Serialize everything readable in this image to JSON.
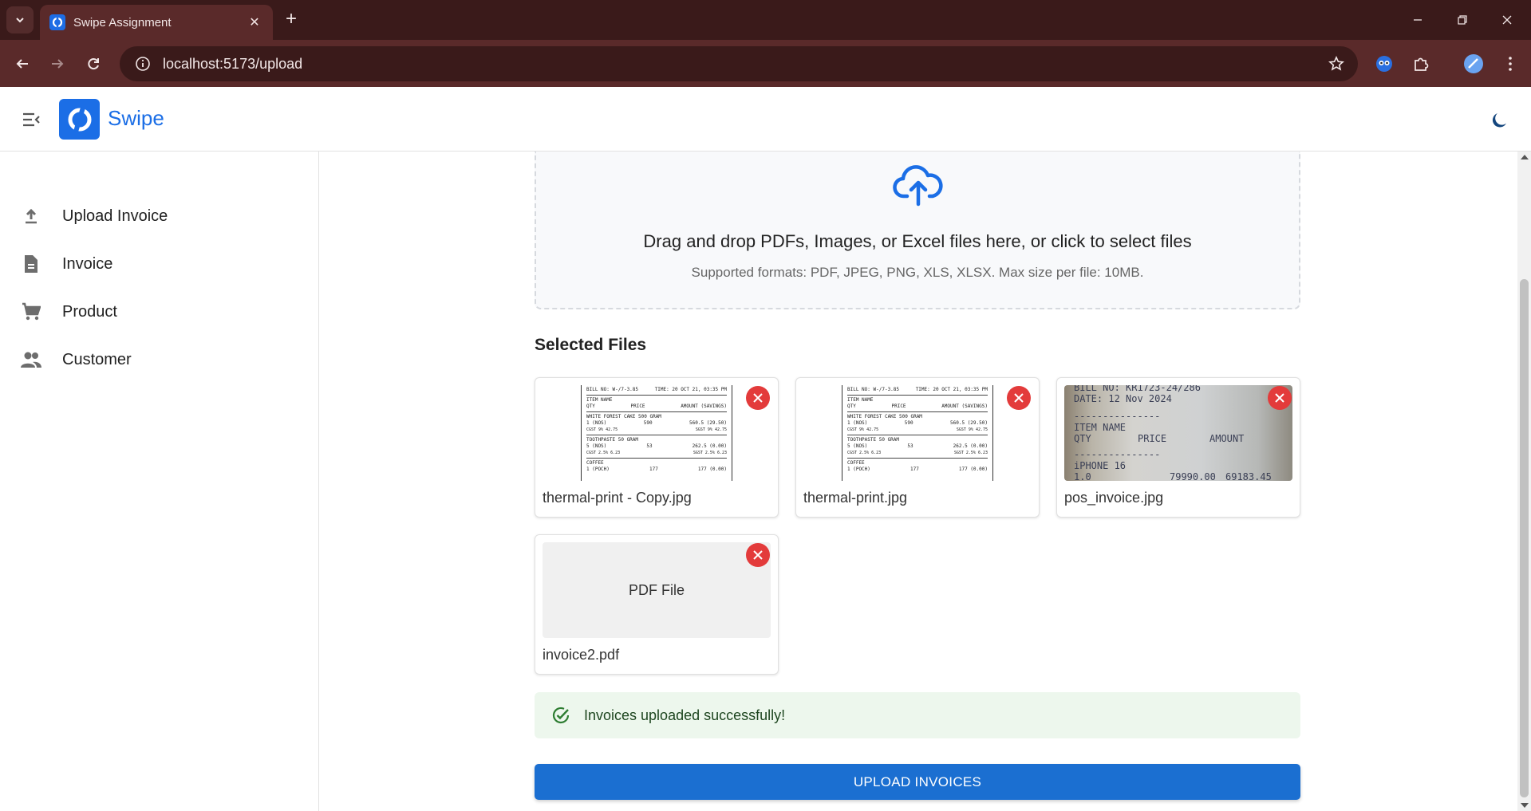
{
  "browser": {
    "tab_title": "Swipe Assignment",
    "url": "localhost:5173/upload"
  },
  "app": {
    "brand": "Swipe"
  },
  "sidebar": {
    "items": [
      {
        "label": "Upload Invoice",
        "icon": "upload-icon"
      },
      {
        "label": "Invoice",
        "icon": "document-icon"
      },
      {
        "label": "Product",
        "icon": "cart-icon"
      },
      {
        "label": "Customer",
        "icon": "people-icon"
      }
    ]
  },
  "dropzone": {
    "title": "Drag and drop PDFs, Images, or Excel files here, or click to select files",
    "subtitle": "Supported formats: PDF, JPEG, PNG, XLS, XLSX. Max size per file: 10MB."
  },
  "selected_files": {
    "heading": "Selected Files",
    "files": [
      {
        "name": "thermal-print - Copy.jpg",
        "type": "image"
      },
      {
        "name": "thermal-print.jpg",
        "type": "image"
      },
      {
        "name": "pos_invoice.jpg",
        "type": "image"
      },
      {
        "name": "invoice2.pdf",
        "type": "pdf",
        "placeholder": "PDF File"
      }
    ]
  },
  "receipt_preview": {
    "header_left": "BILL NO: W-/7-3.85",
    "header_right": "TIME: 20 OCT 21, 03:35 PM",
    "col_item": "ITEM NAME",
    "col_qty": "QTY",
    "col_price": "PRICE",
    "col_amount": "AMOUNT (SAVINGS)",
    "lines": [
      {
        "name": "WHITE FOREST CAKE 500 GRAM",
        "qty": "1 (NOS)",
        "price": "590",
        "amount": "560.5 (29.50)",
        "tax_left": "CGST 9% 42.75",
        "tax_right": "SGST 9% 42.75"
      },
      {
        "name": "TOOTHPASTE 50 GRAM",
        "qty": "5 (NOS)",
        "price": "53",
        "amount": "262.5 (0.00)",
        "tax_left": "CGST 2.5% 6.23",
        "tax_right": "SGST 2.5% 6.23"
      },
      {
        "name": "COFFEE",
        "qty": "1 (POCH)",
        "price": "177",
        "amount": "177 (0.00)"
      }
    ]
  },
  "pos_preview": {
    "bill_no": "BILL NO: KR1723-24/286",
    "date": "DATE: 12 Nov 2024",
    "dashes": "---------------",
    "col_item": "ITEM NAME",
    "col_qty": "QTY",
    "col_price": "PRICE",
    "col_amount": "AMOUNT",
    "item": "iPHONE 16",
    "item_qty": "1.0",
    "item_price": "79990.00",
    "item_amount": "69183.45"
  },
  "alert": {
    "message": "Invoices uploaded successfully!"
  },
  "actions": {
    "upload_label": "UPLOAD INVOICES"
  },
  "colors": {
    "brand": "#1b6ee6",
    "primary_button": "#1b6fd1",
    "remove": "#e33b3b",
    "success_bg": "#edf7ed",
    "success_icon": "#2e7d32"
  }
}
